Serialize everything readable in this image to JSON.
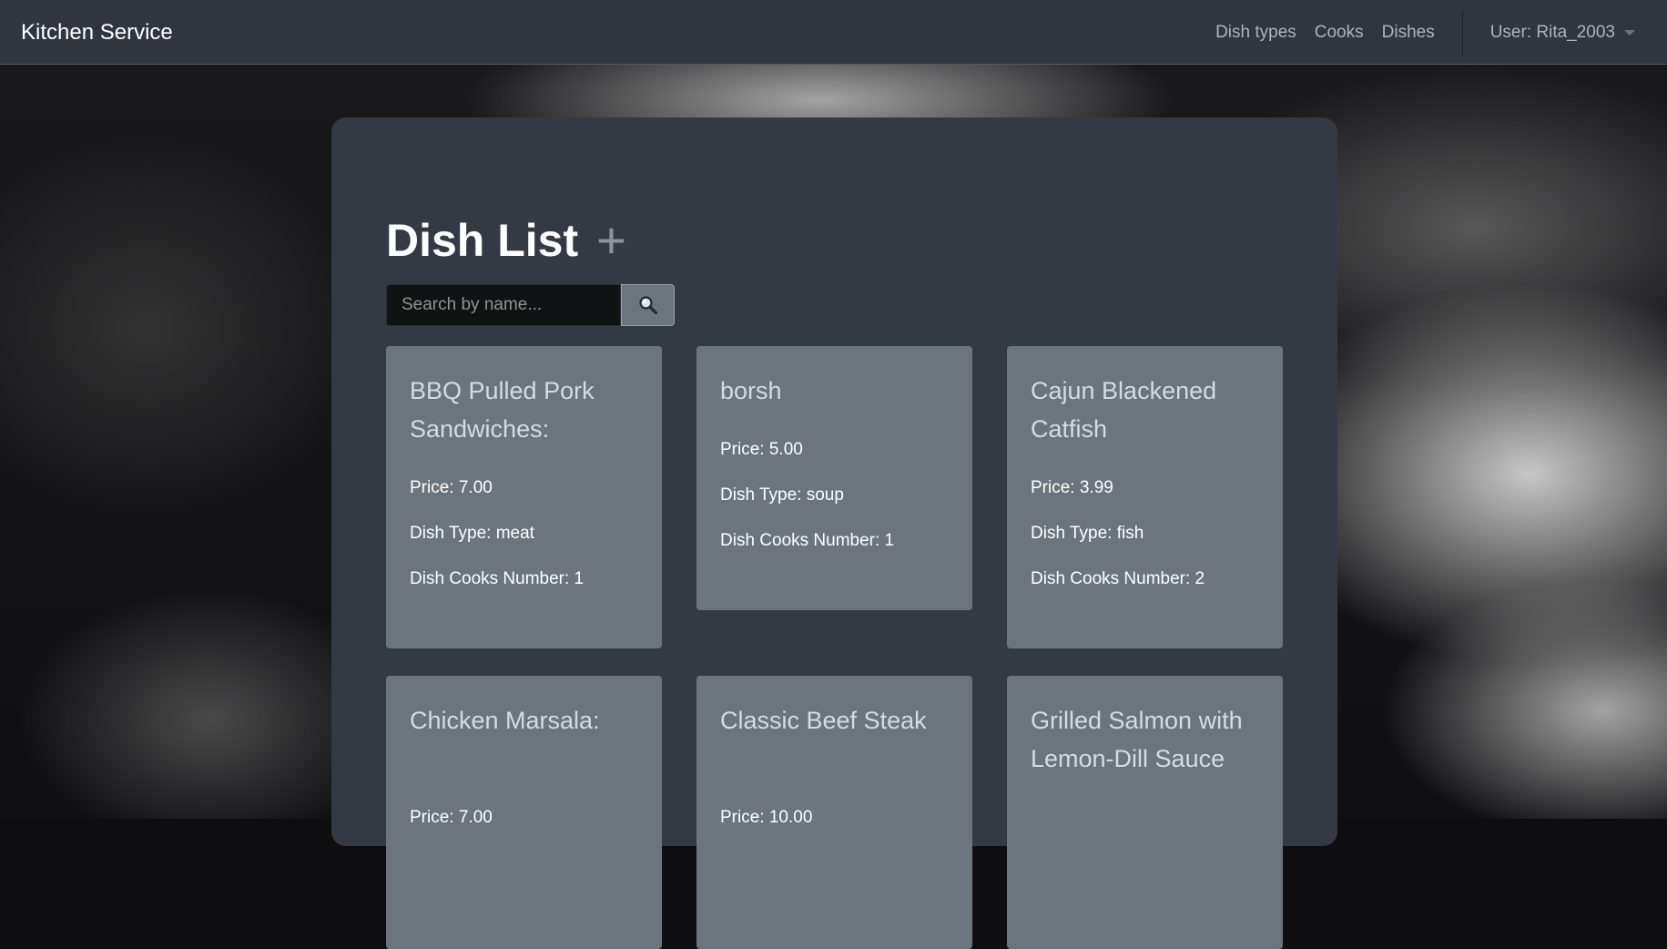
{
  "navbar": {
    "brand": "Kitchen Service",
    "links": [
      "Dish types",
      "Cooks",
      "Dishes"
    ],
    "user_label": "User: Rita_2003"
  },
  "page": {
    "title": "Dish List",
    "add_icon": "+",
    "search": {
      "placeholder": "Search by name...",
      "value": ""
    }
  },
  "dishes": [
    {
      "name": "BBQ Pulled Pork Sandwiches:",
      "price": "Price: 7.00",
      "type": "Dish Type: meat",
      "cooks": "Dish Cooks Number: 1"
    },
    {
      "name": "borsh",
      "price": "Price: 5.00",
      "type": "Dish Type: soup",
      "cooks": "Dish Cooks Number: 1"
    },
    {
      "name": "Cajun Blackened Catfish",
      "price": "Price: 3.99",
      "type": "Dish Type: fish",
      "cooks": "Dish Cooks Number: 2"
    },
    {
      "name": "Chicken Marsala:",
      "price": "Price: 7.00"
    },
    {
      "name": "Classic Beef Steak",
      "price": "Price: 10.00"
    },
    {
      "name": "Grilled Salmon with Lemon-Dill Sauce"
    }
  ],
  "icons": {
    "search_button": "magnifier-icon",
    "add": "plus-icon",
    "user_menu": "caret-down-icon"
  },
  "colors": {
    "navbar_bg": "#31363e",
    "panel_bg": "#343a43",
    "card_bg": "#6c757d",
    "card_title": "#d3dce5"
  }
}
